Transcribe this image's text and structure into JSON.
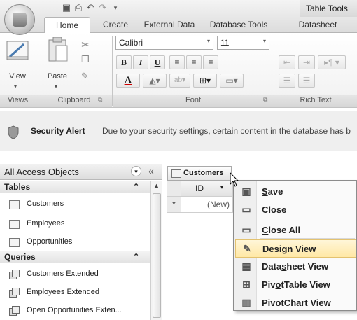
{
  "title_bar": {
    "contextual_title": "Table Tools",
    "office_button": "office-logo-icon",
    "qat": [
      "save-icon",
      "print-icon",
      "undo-icon",
      "customize-qat-icon"
    ]
  },
  "tabs": [
    "Home",
    "Create",
    "External Data",
    "Database Tools",
    "Datasheet"
  ],
  "ribbon": {
    "views": {
      "view_label": "View",
      "group": "Views"
    },
    "clipboard": {
      "paste_label": "Paste",
      "group": "Clipboard"
    },
    "font": {
      "font_name": "Calibri",
      "font_size": "11",
      "bold": "B",
      "italic": "I",
      "underline": "U",
      "font_color": "A",
      "group": "Font"
    },
    "rich_text": {
      "group": "Rich Text"
    }
  },
  "security_alert": {
    "title": "Security Alert",
    "message": "Due to your security settings, certain content in the database has b"
  },
  "nav_pane": {
    "header": "All Access Objects",
    "sections": [
      {
        "title": "Tables",
        "items": [
          "Customers",
          "Employees",
          "Opportunities"
        ]
      },
      {
        "title": "Queries",
        "items": [
          "Customers Extended",
          "Employees Extended",
          "Open Opportunities Exten..."
        ]
      }
    ]
  },
  "datasheet": {
    "tab_title": "Customers",
    "column_header": "ID",
    "new_row_marker": "*",
    "new_row_value": "(New)"
  },
  "context_menu": {
    "items": [
      {
        "pre": "",
        "u": "S",
        "post": "ave",
        "icon": "save-icon"
      },
      {
        "pre": "",
        "u": "C",
        "post": "lose",
        "icon": "close-icon"
      },
      {
        "pre": "",
        "u": "C",
        "post": "lose All",
        "icon": "close-all-icon"
      },
      {
        "pre": "",
        "u": "D",
        "post": "esign View",
        "icon": "design-view-icon"
      },
      {
        "pre": "Data",
        "u": "s",
        "post": "heet View",
        "icon": "datasheet-view-icon"
      },
      {
        "pre": "Piv",
        "u": "o",
        "post": "tTable View",
        "icon": "pivottable-view-icon"
      },
      {
        "pre": "Pi",
        "u": "v",
        "post": "otChart View",
        "icon": "pivotchart-view-icon"
      }
    ],
    "highlighted": "Design View"
  }
}
